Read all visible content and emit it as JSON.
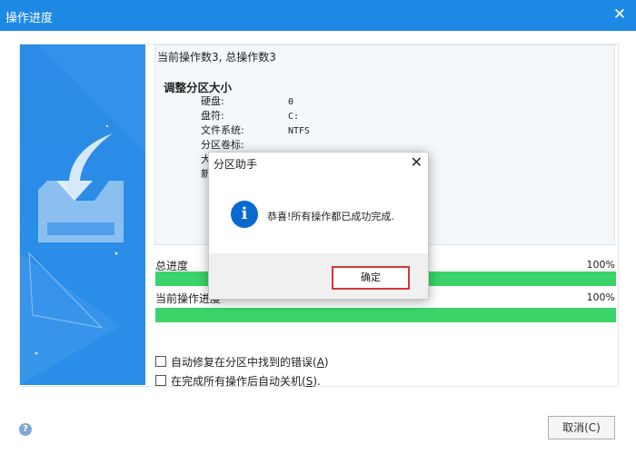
{
  "window": {
    "title": "操作进度"
  },
  "log": {
    "line1": "当前操作数3, 总操作数3",
    "heading": "调整分区大小",
    "rows": [
      {
        "key": "硬盘:",
        "value": "0"
      },
      {
        "key": "盘符:",
        "value": "C:"
      },
      {
        "key": "文件系统:",
        "value": "NTFS"
      },
      {
        "key": "分区卷标:",
        "value": ""
      },
      {
        "key": "大",
        "value": ""
      },
      {
        "key": "新",
        "value": ""
      }
    ]
  },
  "progress": {
    "total_label": "总进度",
    "total_percent": "100%",
    "total_value": 1.0,
    "current_label": "当前操作进度",
    "current_percent": "100%",
    "current_value": 1.0
  },
  "options": {
    "auto_fix_label": "自动修复在分区中找到的错误(",
    "auto_fix_key": "A",
    "auto_fix_suffix": ")",
    "shutdown_label": "在完成所有操作后自动关机(",
    "shutdown_key": "S",
    "shutdown_suffix": ")."
  },
  "footer": {
    "help_glyph": "?",
    "cancel_label": "取消(C)"
  },
  "dialog": {
    "title": "分区助手",
    "message": "恭喜!所有操作都已成功完成.",
    "info_glyph": "i",
    "ok_label": "确定"
  },
  "colors": {
    "titlebar": "#1e88e5",
    "progress_fill": "#3ad46a",
    "ok_border": "#d43737",
    "info_icon": "#0a6ad0"
  }
}
